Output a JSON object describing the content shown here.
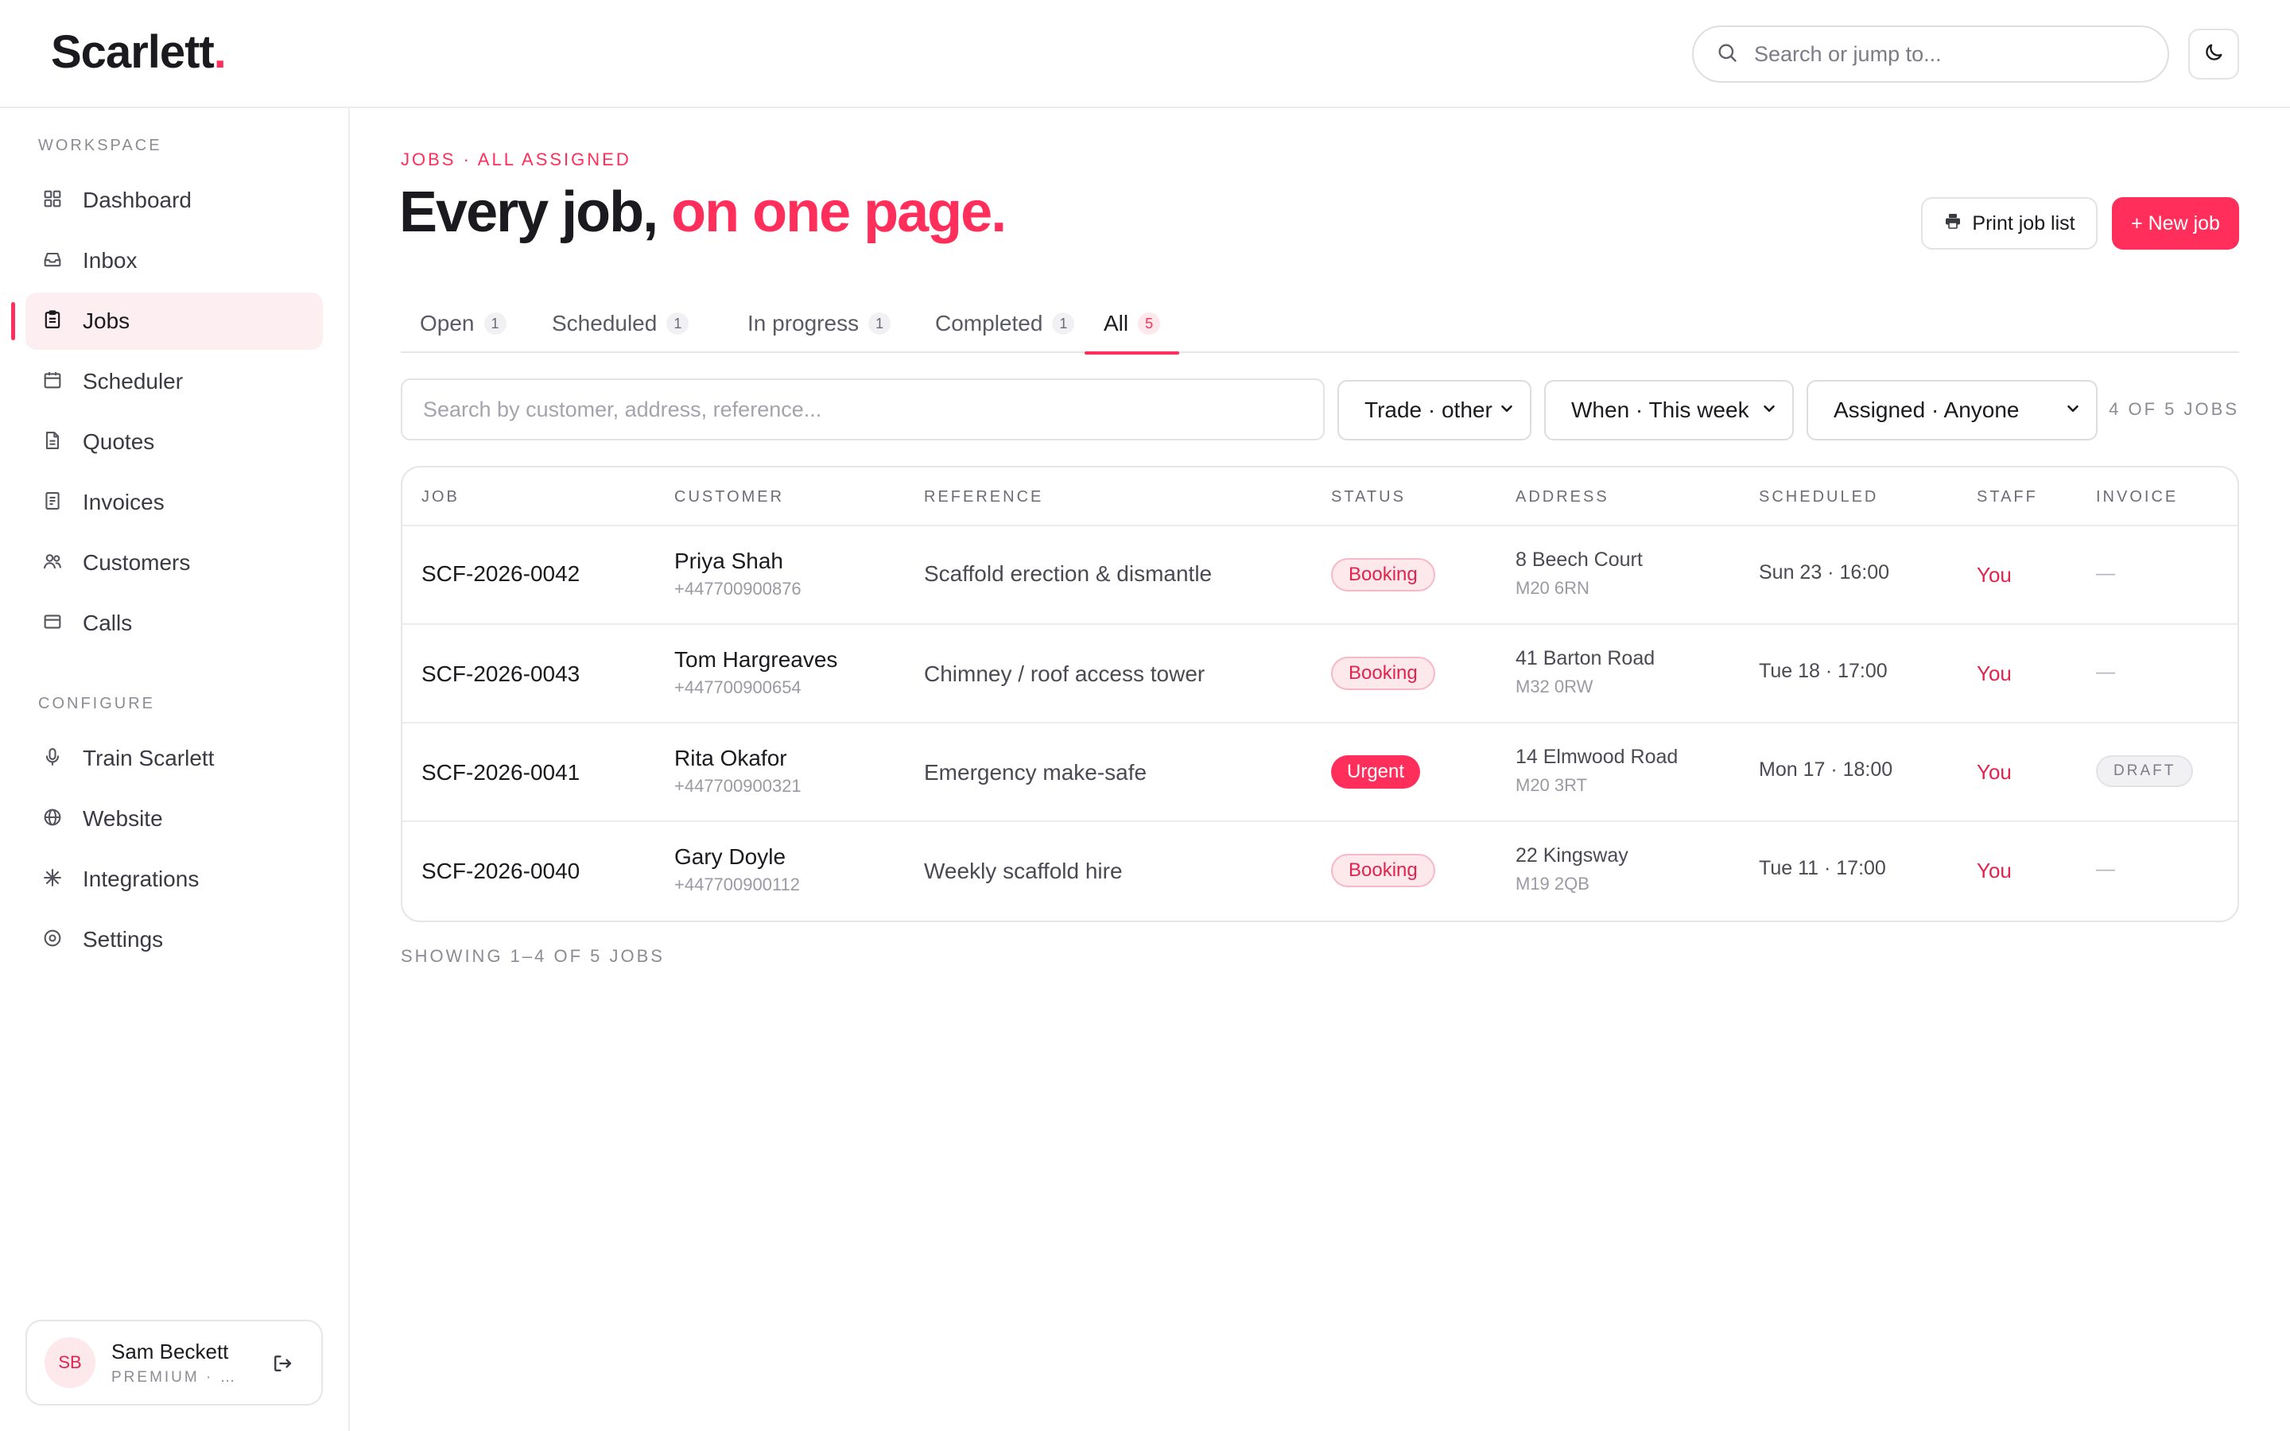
{
  "brand": {
    "name": "Scarlett",
    "dot": ".",
    "accent": "#ff2e5a"
  },
  "header": {
    "search_placeholder": "Search or jump to...",
    "theme_icon": "moon-icon"
  },
  "sidebar": {
    "workspace_label": "WORKSPACE",
    "workspace_items": [
      {
        "label": "Dashboard",
        "icon": "grid-icon"
      },
      {
        "label": "Inbox",
        "icon": "inbox-icon"
      },
      {
        "label": "Jobs",
        "icon": "clipboard-icon",
        "active": true
      },
      {
        "label": "Scheduler",
        "icon": "calendar-icon"
      },
      {
        "label": "Quotes",
        "icon": "document-icon"
      },
      {
        "label": "Invoices",
        "icon": "receipt-icon"
      },
      {
        "label": "Customers",
        "icon": "users-icon"
      },
      {
        "label": "Calls",
        "icon": "card-icon"
      }
    ],
    "configure_label": "CONFIGURE",
    "configure_items": [
      {
        "label": "Train Scarlett",
        "icon": "microphone-icon"
      },
      {
        "label": "Website",
        "icon": "globe-icon"
      },
      {
        "label": "Integrations",
        "icon": "sparkle-icon"
      },
      {
        "label": "Settings",
        "icon": "settings-icon"
      }
    ],
    "user": {
      "initials": "SB",
      "name": "Sam Beckett",
      "plan": "PREMIUM · S..."
    }
  },
  "page": {
    "eyebrow": "JOBS · ALL ASSIGNED",
    "title_main": "Every job,",
    "title_accent": "on one page.",
    "print_button": "Print job list",
    "new_button": "+ New job"
  },
  "tabs": [
    {
      "label": "Open",
      "count": "1"
    },
    {
      "label": "Scheduled",
      "count": "1"
    },
    {
      "label": "In progress",
      "count": "1"
    },
    {
      "label": "Completed",
      "count": "1"
    },
    {
      "label": "All",
      "count": "5",
      "active": true
    }
  ],
  "filters": {
    "search_placeholder": "Search by customer, address, reference...",
    "trade": "Trade · other",
    "when": "When · This week",
    "assigned": "Assigned · Anyone",
    "count_text": "4 OF 5 JOBS"
  },
  "table": {
    "headers": [
      "JOB",
      "CUSTOMER",
      "REFERENCE",
      "STATUS",
      "ADDRESS",
      "SCHEDULED",
      "STAFF",
      "INVOICE"
    ],
    "rows": [
      {
        "job": "SCF-2026-0042",
        "customer": "Priya Shah",
        "phone": "+447700900876",
        "reference": "Scaffold erection & dismantle",
        "status": "Booking",
        "address1": "8 Beech Court",
        "address2": "M20 6RN",
        "scheduled": "Sun 23 · 16:00",
        "staff": "You",
        "invoice": "—"
      },
      {
        "job": "SCF-2026-0043",
        "customer": "Tom Hargreaves",
        "phone": "+447700900654",
        "reference": "Chimney / roof access tower",
        "status": "Booking",
        "address1": "41 Barton Road",
        "address2": "M32 0RW",
        "scheduled": "Tue 18 · 17:00",
        "staff": "You",
        "invoice": "—"
      },
      {
        "job": "SCF-2026-0041",
        "customer": "Rita Okafor",
        "phone": "+447700900321",
        "reference": "Emergency make-safe",
        "status": "Urgent",
        "address1": "14 Elmwood Road",
        "address2": "M20 3RT",
        "scheduled": "Mon 17 · 18:00",
        "staff": "You",
        "invoice": "DRAFT"
      },
      {
        "job": "SCF-2026-0040",
        "customer": "Gary Doyle",
        "phone": "+447700900112",
        "reference": "Weekly scaffold hire",
        "status": "Booking",
        "address1": "22 Kingsway",
        "address2": "M19 2QB",
        "scheduled": "Tue 11 · 17:00",
        "staff": "You",
        "invoice": "—"
      }
    ],
    "footer": "SHOWING 1–4 OF 5 JOBS"
  }
}
